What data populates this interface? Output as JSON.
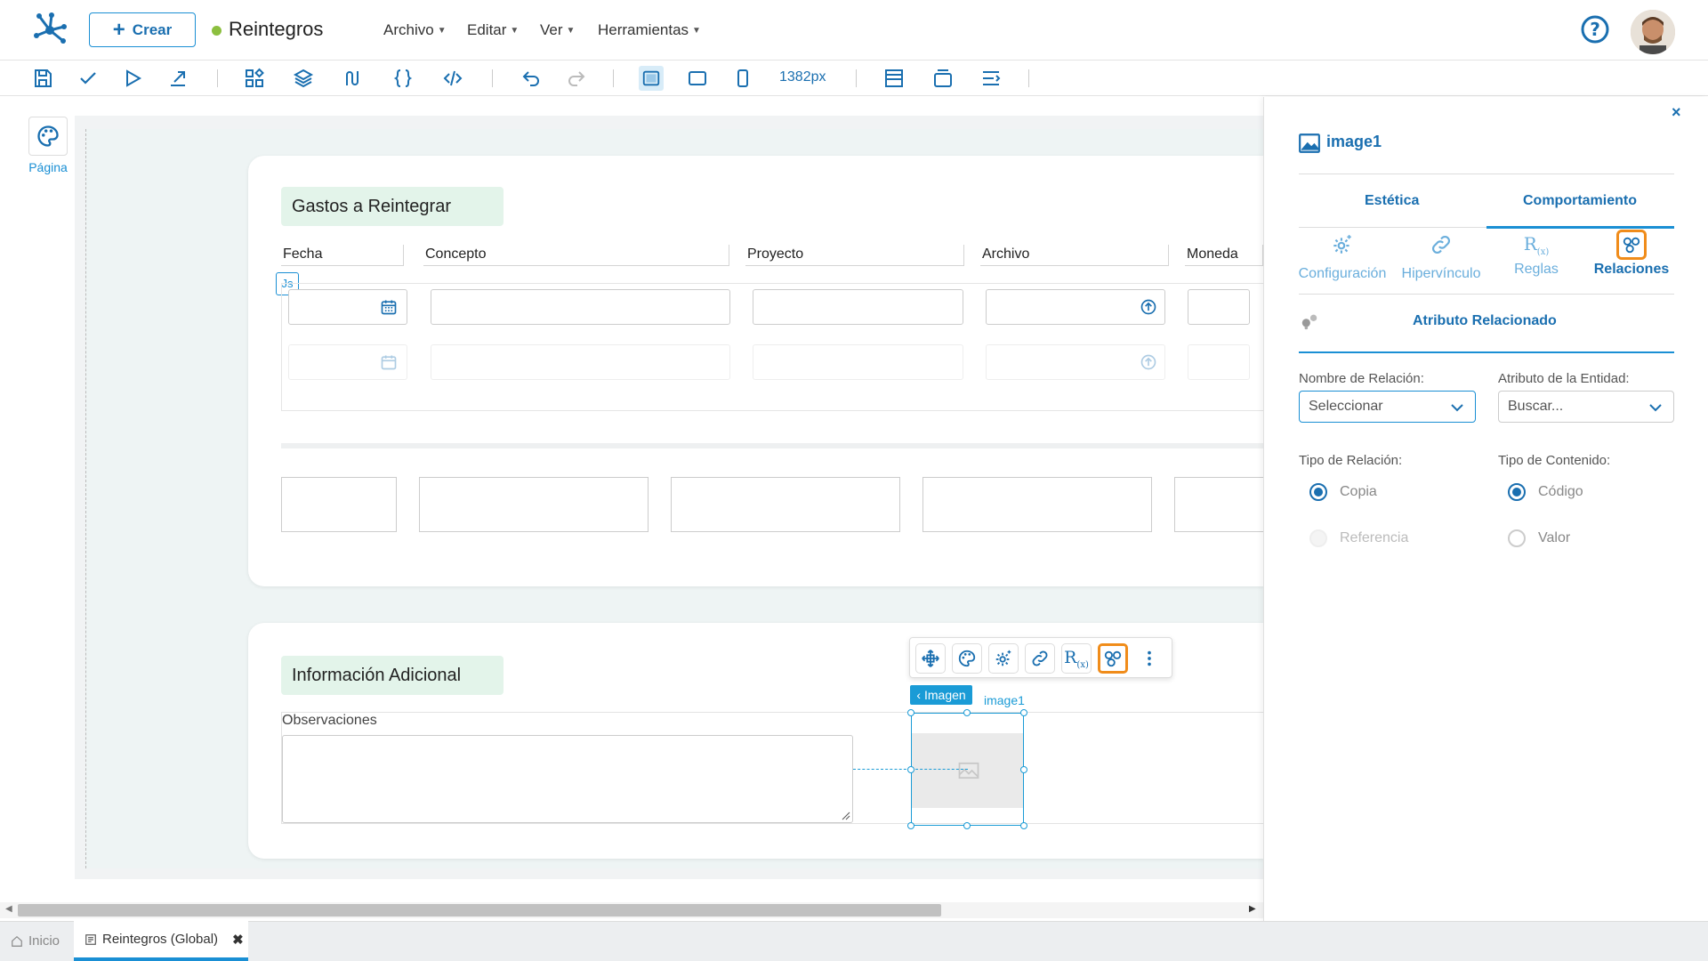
{
  "header": {
    "create_label": "Crear",
    "app_title": "Reintegros",
    "menus": [
      "Archivo",
      "Editar",
      "Ver",
      "Herramientas"
    ]
  },
  "toolbar": {
    "zoom_label": "1382px"
  },
  "left_rail": {
    "page_label": "Página"
  },
  "canvas": {
    "section1_title": "Gastos a Reintegrar",
    "columns": [
      "Fecha",
      "Concepto",
      "Proyecto",
      "Archivo",
      "Moneda"
    ],
    "js_badge": "Js",
    "section2_title": "Información Adicional",
    "observaciones_label": "Observaciones",
    "imagen_tag": "Imagen",
    "image_name": "image1"
  },
  "panel": {
    "component_name": "image1",
    "tabs": [
      "Estética",
      "Comportamiento"
    ],
    "sub_tabs": [
      "Configuración",
      "Hipervínculo",
      "Reglas",
      "Relaciones"
    ],
    "section_title": "Atributo Relacionado",
    "relation_name_label": "Nombre de Relación:",
    "relation_name_value": "Seleccionar",
    "entity_attr_label": "Atributo de la Entidad:",
    "entity_attr_placeholder": "Buscar...",
    "relation_type_label": "Tipo de Relación:",
    "relation_type_options": [
      "Copia",
      "Referencia"
    ],
    "content_type_label": "Tipo de Contenido:",
    "content_type_options": [
      "Código",
      "Valor"
    ]
  },
  "bottom_tabs": {
    "home": "Inicio",
    "current": "Reintegros (Global)"
  },
  "colors": {
    "primary": "#1a6fb0",
    "accent_orange": "#f08c1a",
    "section_bg": "#e3f4ea",
    "status_green": "#8cbf3f"
  }
}
